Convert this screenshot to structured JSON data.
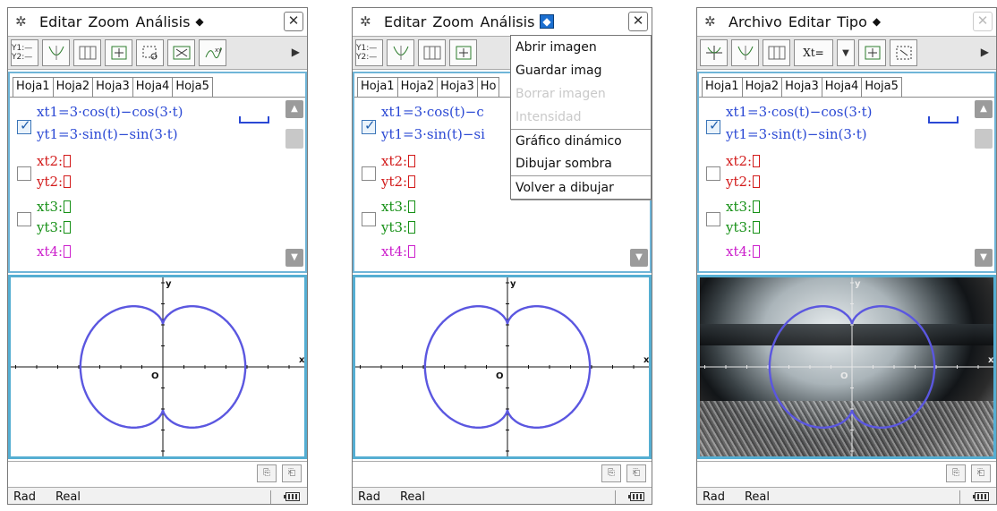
{
  "menu1": {
    "left": "Editar",
    "mid": "Zoom",
    "right": "Análisis",
    "diamond": "◆",
    "close": "✕"
  },
  "menu3": {
    "left": "Archivo",
    "mid": "Editar",
    "right": "Tipo",
    "diamond": "◆",
    "close": "✕"
  },
  "toolbar": {
    "y_label": "Y1:— Y2:—",
    "xt_label": "Xt=",
    "drop": "▼",
    "more": "▶"
  },
  "tabs": [
    "Hoja1",
    "Hoja2",
    "Hoja3",
    "Hoja4",
    "Hoja5"
  ],
  "tabs_partial": [
    "Hoja1",
    "Hoja2",
    "Hoja3",
    "Ho"
  ],
  "equations": {
    "xt1": "xt1=3·cos(t)−cos(3·t)",
    "yt1": "yt1=3·sin(t)−sin(3·t)",
    "xt1_cut": "xt1=3·cos(t)−c",
    "yt1_cut": "yt1=3·sin(t)−si",
    "xt2": "xt2:",
    "yt2": "yt2:",
    "xt3": "xt3:",
    "yt3": "yt3:",
    "xt4": "xt4:"
  },
  "axes": {
    "x": "x",
    "y": "y",
    "origin": "O"
  },
  "dropdown": {
    "items": [
      "Abrir imagen",
      "Guardar imag",
      "Borrar imagen",
      "Intensidad",
      "Gráfico dinámico",
      "Dibujar sombra",
      "Volver a dibujar"
    ],
    "disabled": [
      false,
      false,
      true,
      true,
      false,
      false,
      false
    ]
  },
  "status": {
    "mode": "Rad",
    "real": "Real"
  },
  "colors": {
    "curve": "#5b57e0",
    "panel_border": "#55aed2",
    "menu_active": "#1b6fd0"
  }
}
